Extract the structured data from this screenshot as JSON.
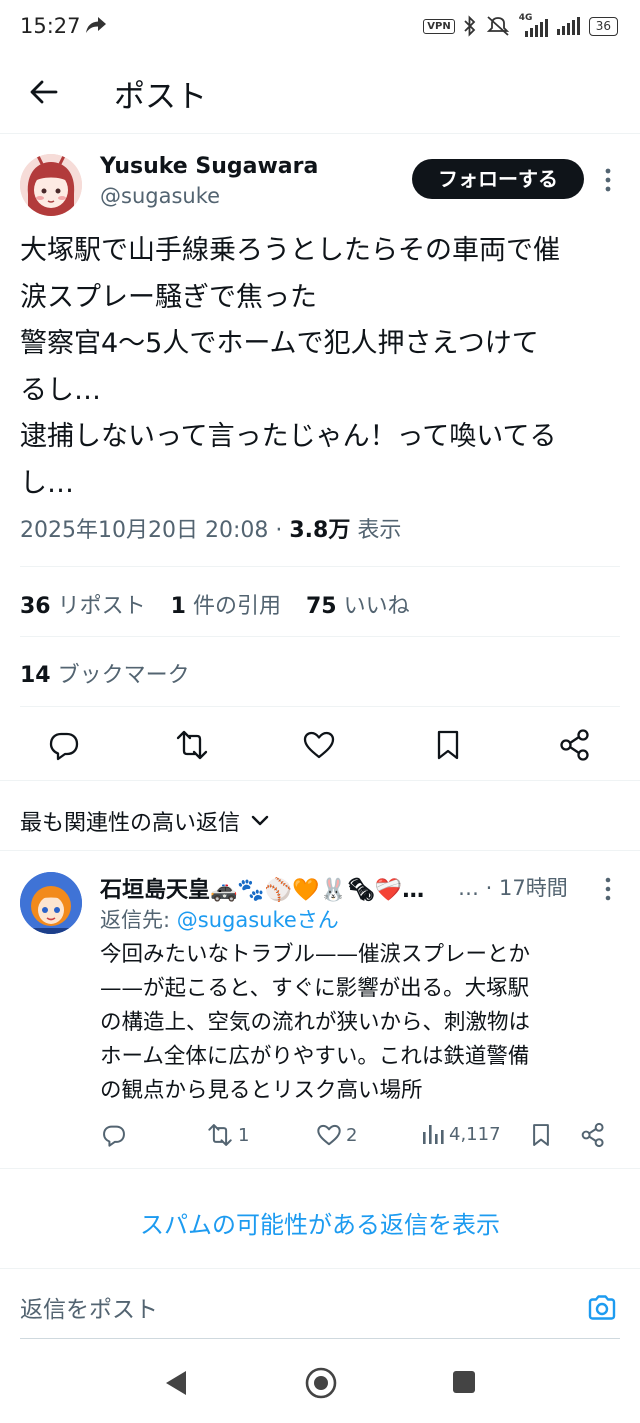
{
  "status_bar": {
    "time": "15:27",
    "vpn": "VPN",
    "network": "4G",
    "battery": "36"
  },
  "header": {
    "title": "ポスト"
  },
  "post": {
    "author_name": "Yusuke Sugawara",
    "author_handle": "@sugasuke",
    "follow_label": "フォローする",
    "text": "大塚駅で山手線乗ろうとしたらその車両で催\n涙スプレー騒ぎで焦った\n警察官4〜5人でホームで犯人押さえつけて\nるし…\n逮捕しないって言ったじゃん！って喚いてる\nし…",
    "datetime": "2025年10月20日 20:08",
    "separator": "·",
    "views": "3.8万",
    "views_label": "表示",
    "reposts_count": "36",
    "reposts_label": "リポスト",
    "quotes_count": "1",
    "quotes_label": "件の引用",
    "likes_count": "75",
    "likes_label": "いいね",
    "bookmarks_count": "14",
    "bookmarks_label": "ブックマーク"
  },
  "sort": {
    "label": "最も関連性の高い返信"
  },
  "reply": {
    "name": "石垣島天皇🚓🐾⚾🧡🐰🗞❤️‍🩹…",
    "time": "… · 17時間",
    "reply_to_prefix": "返信先: ",
    "reply_to_handle": "@sugasukeさん",
    "text": "今回みたいなトラブル——催涙スプレーとか\n——が起こると、すぐに影響が出る。大塚駅\nの構造上、空気の流れが狭いから、刺激物は\nホーム全体に広がりやすい。これは鉄道警備\nの観点から見るとリスク高い場所",
    "reposts": "1",
    "likes": "2",
    "views": "4,117"
  },
  "spam_link": "スパムの可能性がある返信を表示",
  "compose": {
    "placeholder": "返信をポスト"
  },
  "colors": {
    "accent": "#1d9bf0",
    "text": "#0f1419",
    "muted": "#536471"
  }
}
